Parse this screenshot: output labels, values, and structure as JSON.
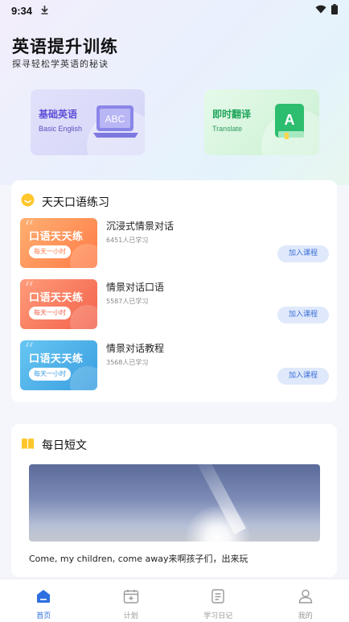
{
  "status_bar": {
    "time": "9:34"
  },
  "header": {
    "title": "英语提升训练",
    "subtitle": "探寻轻松学英语的秘诀"
  },
  "feature_cards": [
    {
      "title": "基础英语",
      "subtitle": "Basic English",
      "icon": "abc-laptop-icon",
      "accent": "#5d4fd8"
    },
    {
      "title": "即时翻译",
      "subtitle": "Translate",
      "icon": "translate-book-icon",
      "accent": "#1ea55a"
    }
  ],
  "daily_practice": {
    "title": "天天口语练习",
    "courses": [
      {
        "thumb_title": "口语天天练",
        "thumb_tag": "每天一小时",
        "name": "沉浸式情景对话",
        "count": "6451人已学习",
        "button": "加入课程",
        "color": "#ff7a45"
      },
      {
        "thumb_title": "口语天天练",
        "thumb_tag": "每天一小时",
        "name": "情景对话口语",
        "count": "5587人已学习",
        "button": "加入课程",
        "color": "#f2614a"
      },
      {
        "thumb_title": "口语天天练",
        "thumb_tag": "每天一小时",
        "name": "情景对话教程",
        "count": "3568人已学习",
        "button": "加入课程",
        "color": "#3a9ee0"
      }
    ]
  },
  "daily_article": {
    "title": "每日短文",
    "text": "Come, my children, come away来啊孩子们，出来玩"
  },
  "tabbar": {
    "items": [
      {
        "label": "首页",
        "icon": "home-icon",
        "active": true
      },
      {
        "label": "计划",
        "icon": "calendar-icon",
        "active": false
      },
      {
        "label": "学习日记",
        "icon": "diary-icon",
        "active": false
      },
      {
        "label": "我的",
        "icon": "profile-icon",
        "active": false
      }
    ],
    "active_color": "#2f6fe0"
  }
}
